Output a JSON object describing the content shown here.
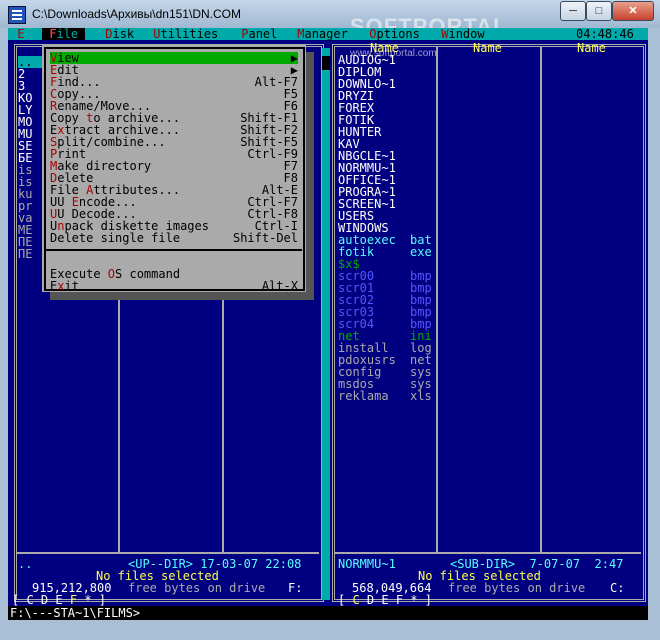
{
  "window": {
    "title": "C:\\Downloads\\Архивы\\dn151\\DN.COM",
    "watermark": "SOFTPORTAL",
    "watermark_sub": "www.softportal.com",
    "min": "─",
    "max": "□",
    "close": "✕"
  },
  "menubar": {
    "items": [
      {
        "pre": "",
        "hk": "E",
        "post": ""
      },
      {
        "pre": "",
        "hk": "F",
        "post": "ile"
      },
      {
        "pre": "",
        "hk": "D",
        "post": "isk"
      },
      {
        "pre": "",
        "hk": "U",
        "post": "tilities"
      },
      {
        "pre": "",
        "hk": "P",
        "post": "anel"
      },
      {
        "pre": "",
        "hk": "M",
        "post": "anager"
      },
      {
        "pre": "",
        "hk": "O",
        "post": "ptions"
      },
      {
        "pre": "",
        "hk": "W",
        "post": "indow"
      }
    ],
    "clock": "04:48:46"
  },
  "file_menu": {
    "items": [
      {
        "pre": "",
        "hk": "V",
        "post": "iew",
        "shortcut": "▶",
        "selected": true
      },
      {
        "pre": "",
        "hk": "E",
        "post": "dit",
        "shortcut": "▶"
      },
      {
        "pre": "",
        "hk": "F",
        "post": "ind...",
        "shortcut": "Alt-F7"
      },
      {
        "pre": "",
        "hk": "C",
        "post": "opy...",
        "shortcut": "F5"
      },
      {
        "pre": "",
        "hk": "R",
        "post": "ename/Move...",
        "shortcut": "F6"
      },
      {
        "pre": "Copy ",
        "hk": "t",
        "post": "o archive...",
        "shortcut": "Shift-F1"
      },
      {
        "pre": "E",
        "hk": "x",
        "post": "tract archive...",
        "shortcut": "Shift-F2"
      },
      {
        "pre": "",
        "hk": "S",
        "post": "plit/combine...",
        "shortcut": "Shift-F5"
      },
      {
        "pre": "",
        "hk": "P",
        "post": "rint",
        "shortcut": "Ctrl-F9"
      },
      {
        "pre": "",
        "hk": "M",
        "post": "ake directory",
        "shortcut": "F7"
      },
      {
        "pre": "",
        "hk": "D",
        "post": "elete",
        "shortcut": "F8"
      },
      {
        "pre": "File ",
        "hk": "A",
        "post": "ttributes...",
        "shortcut": "Alt-E"
      },
      {
        "pre": "UU ",
        "hk": "E",
        "post": "ncode...",
        "shortcut": "Ctrl-F7"
      },
      {
        "pre": "",
        "hk": "U",
        "post": "U Decode...",
        "shortcut": "Ctrl-F8"
      },
      {
        "pre": "U",
        "hk": "n",
        "post": "pack diskette images",
        "shortcut": "Ctrl-I"
      },
      {
        "pre": "Delete single file",
        "hk": "",
        "post": "",
        "shortcut": "Shift-Del"
      },
      {
        "pre": "Execute ",
        "hk": "O",
        "post": "S command",
        "shortcut": ""
      },
      {
        "pre": "E",
        "hk": "x",
        "post": "it",
        "shortcut": "Alt-X"
      }
    ]
  },
  "left_panel": {
    "peek": [
      "..",
      "2",
      "3",
      "КО",
      "LY",
      "МО",
      "MU",
      "SE",
      "БЕ",
      "is",
      "is",
      "ku",
      "pr",
      "va",
      "МЕ",
      "ПЕ",
      "ПЕ"
    ],
    "current": "..",
    "info": "<UP--DIR> 17-03-07 22:08",
    "selection": "No files selected",
    "free": "915,212,800",
    "free_text": "free bytes on drive",
    "drive": "F:",
    "drives": [
      "C",
      "D",
      "E",
      "F",
      "*"
    ],
    "active_drive": "F"
  },
  "right_panel": {
    "header": [
      "Name",
      "Name",
      "Name"
    ],
    "dirs": [
      "AUDIOG~1",
      "DIPLOM",
      "DOWNLO~1",
      "DRYZI",
      "FOREX",
      "FOTIK",
      "HUNTER",
      "KAV",
      "NBGCLE~1",
      "NORMMU~1",
      "OFFICE~1",
      "PROGRA~1",
      "SCREEN~1",
      "USERS",
      "WINDOWS"
    ],
    "files": [
      {
        "name": "autoexec",
        "ext": "bat",
        "color": "#55ffff"
      },
      {
        "name": "fotik",
        "ext": "exe",
        "color": "#55ffff"
      },
      {
        "name": "$x$",
        "ext": "",
        "color": "#00aa00"
      },
      {
        "name": "scr00",
        "ext": "bmp",
        "color": "#5555ff"
      },
      {
        "name": "scr01",
        "ext": "bmp",
        "color": "#5555ff"
      },
      {
        "name": "scr02",
        "ext": "bmp",
        "color": "#5555ff"
      },
      {
        "name": "scr03",
        "ext": "bmp",
        "color": "#5555ff"
      },
      {
        "name": "scr04",
        "ext": "bmp",
        "color": "#5555ff"
      },
      {
        "name": "net",
        "ext": "ini",
        "color": "#00aa00"
      },
      {
        "name": "install",
        "ext": "log",
        "color": "#aaaaaa"
      },
      {
        "name": "pdoxusrs",
        "ext": "net",
        "color": "#aaaaaa"
      },
      {
        "name": "config",
        "ext": "sys",
        "color": "#aaaaaa"
      },
      {
        "name": "msdos",
        "ext": "sys",
        "color": "#aaaaaa"
      },
      {
        "name": "reklama",
        "ext": "xls",
        "color": "#aaaaaa"
      }
    ],
    "current": "NORMMU~1",
    "info": "<SUB-DIR>  7-07-07  2:47",
    "selection": "No files selected",
    "free": "568,049,664",
    "free_text": "free bytes on drive",
    "drive": "C:",
    "drives": [
      "C",
      "D",
      "E",
      "F",
      "*"
    ],
    "active_drive": "C"
  },
  "command_line": {
    "prompt": "F:\\---STA~1\\FILMS>"
  }
}
